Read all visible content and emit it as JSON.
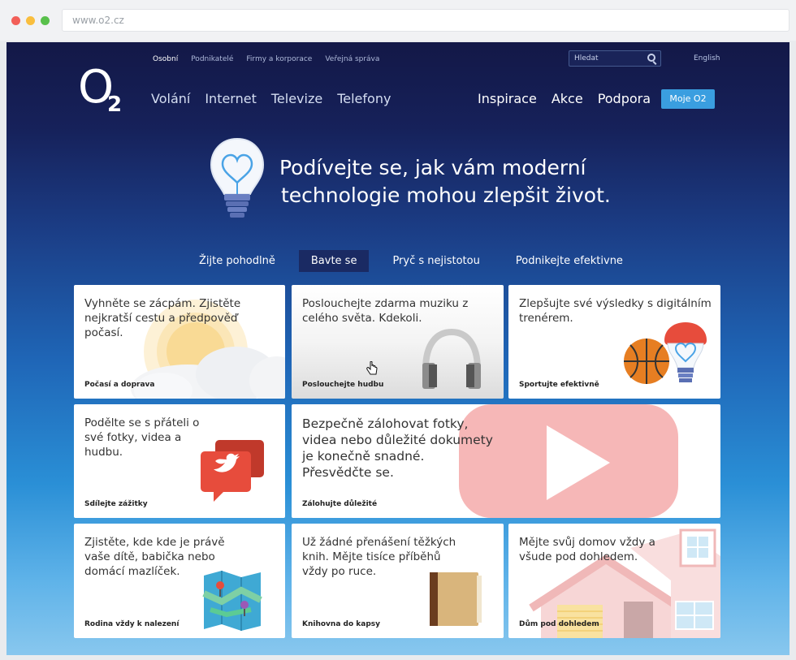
{
  "browser": {
    "url": "www.o2.cz"
  },
  "header": {
    "logo": {
      "letter": "O",
      "digit": "2"
    },
    "subnav": [
      "Osobní",
      "Podnikatelé",
      "Firmy a korporace",
      "Veřejná správa"
    ],
    "search_placeholder": "Hledat",
    "language": "English",
    "mainnav": [
      "Volání",
      "Internet",
      "Televize",
      "Telefony"
    ],
    "rightnav": [
      "Inspirace",
      "Akce",
      "Podpora"
    ],
    "account_button": "Moje O2"
  },
  "hero": {
    "line1": "Podívejte se, jak vám moderní",
    "line2": "technologie mohou zlepšit život."
  },
  "tabs": [
    {
      "label": "Žijte pohodlně"
    },
    {
      "label": "Bavte se"
    },
    {
      "label": "Pryč s nejistotou"
    },
    {
      "label": "Podnikejte efektivne"
    }
  ],
  "cards": [
    {
      "title": "Vyhněte se zácpám. Zjistěte nejkratší cestu a předpověď počasí.",
      "label": "Počasí a doprava"
    },
    {
      "title": "Poslouchejte zdarma muziku z celého světa. Kdekoli.",
      "label": "Poslouchejte hudbu"
    },
    {
      "title": "Zlepšujte své výsledky s digitálním trenérem.",
      "label": "Sportujte efektivně"
    },
    {
      "title": "Podělte se s přáteli o své fotky, videa a hudbu.",
      "label": "Sdílejte zážitky"
    },
    {
      "title": "Bezpečně zálohovat fotky, videa nebo důležité dokumety je konečně snadné. Přesvědčte se.",
      "label": "Zálohujte důležité"
    },
    {
      "title": "Zjistěte, kde kde je právě vaše dítě, babička nebo domácí mazlíček.",
      "label": "Rodina vždy k nalezení"
    },
    {
      "title": "Už žádné přenášení těžkých knih. Mějte tisíce příběhů vždy po ruce.",
      "label": "Knihovna do kapsy"
    },
    {
      "title": "Mějte svůj domov vždy a všude pod dohledem.",
      "label": "Dům pod dohledem"
    }
  ],
  "colors": {
    "accent": "#3a9ee0",
    "active_tab": "#1a2a63",
    "twitter_bubble": "#e74c3c",
    "youtube": "#f4a9a9"
  }
}
